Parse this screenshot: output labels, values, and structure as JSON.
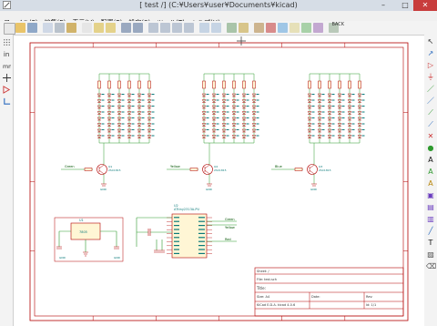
{
  "window": {
    "title": "[ test /] (C:¥Users¥user¥Documents¥kicad)",
    "minimize": "–",
    "maximize": "□",
    "close": "✕"
  },
  "menubar": {
    "items": [
      "ファイル(F)",
      "編集(E)",
      "表示(V)",
      "配置(P)",
      "設定(S)",
      "ツール(T)",
      "ヘルプ(H)"
    ]
  },
  "toolbar": {
    "back_label": "BACK",
    "icons": [
      "new-sheet-icon",
      "open-icon",
      "save-icon",
      "sheet-setup-icon",
      "print-icon",
      "plot-icon",
      "paste-icon",
      "undo-icon",
      "redo-icon",
      "find-icon",
      "find-replace-icon",
      "zoom-in-icon",
      "zoom-out-icon",
      "zoom-redraw-icon",
      "zoom-fit-icon",
      "hierarchy-icon",
      "leave-sheet-icon",
      "library-editor-icon",
      "library-browser-icon",
      "annotate-icon",
      "erc-icon",
      "netlist-icon",
      "bom-icon",
      "cvpcb-icon",
      "pcbnew-icon"
    ]
  },
  "schematic": {
    "blocks": [
      {
        "net_label": "Green",
        "q_ref": "Q1",
        "q_value": "2SC1815"
      },
      {
        "net_label": "Yellow",
        "q_ref": "Q2",
        "q_value": "2SC1815"
      },
      {
        "net_label": "Blue",
        "q_ref": "Q3",
        "q_value": "2SC1815"
      }
    ],
    "gnd_label": "GND",
    "regulator": {
      "ref": "U1",
      "value": "7805"
    },
    "mcu": {
      "ref": "U2",
      "value": "ATtiny2313A-PU",
      "out_labels": [
        "Green",
        "Yellow",
        "Red"
      ]
    },
    "title_block": {
      "sheet": "Sheet: /",
      "file": "File: test.sch",
      "title_label": "Title:",
      "size_label": "Size: A4",
      "date_label": "Date:",
      "kicad": "KiCad E.D.A.  kicad 4.0.6",
      "rev_label": "Rev:",
      "id_label": "Id: 1/1"
    }
  },
  "colors": {
    "wire": "#2e9a2e",
    "component": "#b20000",
    "text": "#0a7a7a",
    "border": "#b20000",
    "label": "#005500"
  }
}
